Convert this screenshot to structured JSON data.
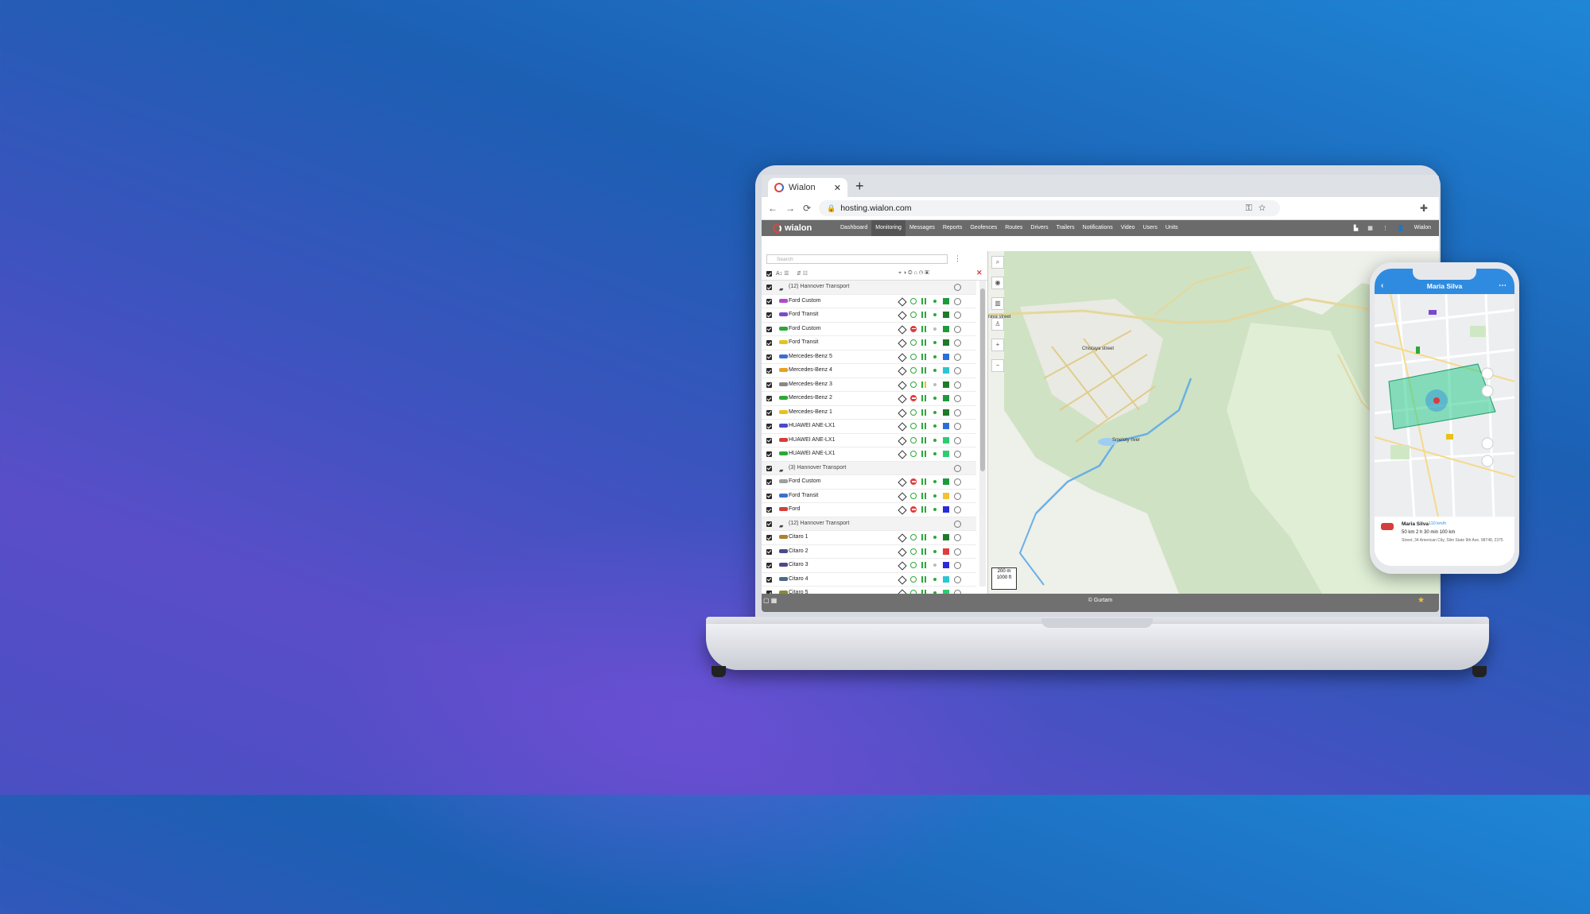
{
  "browser": {
    "tab_title": "Wialon",
    "new_tab": "+",
    "close_tab": "✕",
    "url": "hosting.wialon.com"
  },
  "app": {
    "brand": "wialon",
    "menu": [
      "Dashboard",
      "Monitoring",
      "Messages",
      "Reports",
      "Geofences",
      "Routes",
      "Drivers",
      "Trailers",
      "Notifications",
      "Video",
      "Users",
      "Units"
    ],
    "active_menu": "Monitoring",
    "user": "Wialon",
    "search_placeholder": "Search",
    "footer": "© Gurtam"
  },
  "units": [
    {
      "type": "group",
      "name": "(12) Hannover Transport"
    },
    {
      "type": "unit",
      "name": "Ford Custom",
      "color": "#b04acb",
      "state": "ok",
      "sig": "#2ca83a",
      "sq": "#1f9a3a"
    },
    {
      "type": "unit",
      "name": "Ford Transit",
      "color": "#7a4acb",
      "state": "ok",
      "sig": "#2ca83a",
      "sq": "#1f7a2a"
    },
    {
      "type": "unit",
      "name": "Ford Custom",
      "color": "#2ca83a",
      "state": "stop",
      "sig": "#bbbbbb",
      "sq": "#1f9a3a"
    },
    {
      "type": "unit",
      "name": "Ford Transit",
      "color": "#e7c21b",
      "state": "ok",
      "sig": "#2ca83a",
      "sq": "#1f7a2a"
    },
    {
      "type": "unit",
      "name": "Mercedes-Benz 5",
      "color": "#3a6fd0",
      "state": "ok",
      "sig": "#2ca83a",
      "sq": "#2b6fd6"
    },
    {
      "type": "unit",
      "name": "Mercedes-Benz 4",
      "color": "#e7a21b",
      "state": "ok",
      "sig": "#2ca83a",
      "sq": "#2cc6d0"
    },
    {
      "type": "unit",
      "name": "Mercedes-Benz 3",
      "color": "#888888",
      "state": "ok",
      "sig": "#bbbbbb",
      "sq": "#1f7a2a",
      "warn": true
    },
    {
      "type": "unit",
      "name": "Mercedes-Benz 2",
      "color": "#2ca83a",
      "state": "stop",
      "sig": "#2ca83a",
      "sq": "#1f9a3a"
    },
    {
      "type": "unit",
      "name": "Mercedes-Benz 1",
      "color": "#e7c21b",
      "state": "ok",
      "sig": "#2ca83a",
      "sq": "#1f7a2a"
    },
    {
      "type": "unit",
      "name": "HUAWEI ANE-LX1",
      "color": "#4a4acb",
      "state": "ok",
      "sig": "#2ca83a",
      "sq": "#2b6fd6"
    },
    {
      "type": "unit",
      "name": "HUAWEI ANE-LX1",
      "color": "#d63d3d",
      "state": "ok",
      "sig": "#2ca83a",
      "sq": "#2ecc71"
    },
    {
      "type": "unit",
      "name": "HUAWEI ANE-LX1",
      "color": "#2ca83a",
      "state": "ok",
      "sig": "#2ca83a",
      "sq": "#2ecc71"
    },
    {
      "type": "group",
      "name": "(3) Hannover Transport"
    },
    {
      "type": "unit",
      "name": "Ford Custom",
      "color": "#a0a0a0",
      "state": "stop",
      "sig": "#2ca83a",
      "sq": "#1f9a3a"
    },
    {
      "type": "unit",
      "name": "Ford Transit",
      "color": "#3a6fd0",
      "state": "ok",
      "sig": "#2ca83a",
      "sq": "#f2c233"
    },
    {
      "type": "unit",
      "name": "Ford",
      "color": "#d63d3d",
      "state": "stop",
      "sig": "#2ca83a",
      "sq": "#2b2bd6"
    },
    {
      "type": "group",
      "name": "(12) Hannover Transport"
    },
    {
      "type": "unit",
      "name": "Citaro 1",
      "color": "#b08030",
      "state": "ok",
      "sig": "#2ca83a",
      "sq": "#1f7a2a"
    },
    {
      "type": "unit",
      "name": "Citaro 2",
      "color": "#4a4a8a",
      "state": "ok",
      "sig": "#2ca83a",
      "sq": "#e23b3b"
    },
    {
      "type": "unit",
      "name": "Citaro 3",
      "color": "#4a4a8a",
      "state": "ok",
      "sig": "#bbbbbb",
      "sq": "#2b2bd6"
    },
    {
      "type": "unit",
      "name": "Citaro 4",
      "color": "#4a6a8a",
      "state": "ok",
      "sig": "#2ca83a",
      "sq": "#2cc6d0"
    },
    {
      "type": "unit",
      "name": "Citaro 5",
      "color": "#8a8a30",
      "state": "ok",
      "sig": "#2ca83a",
      "sq": "#2ecc71"
    }
  ],
  "map": {
    "labels": [
      "raya street",
      "Chistaya street",
      "Smeloty river"
    ],
    "scale_m": "200 m",
    "scale_ft": "1000 ft"
  },
  "phone": {
    "title": "Maria Silva",
    "driver": "Maria Silva",
    "speed": "110 km/h",
    "stats": "50 km   2 h 30 min   100 km",
    "address": "Street, 34 American City, Slim State 9th Ave. 98748, 2375"
  }
}
